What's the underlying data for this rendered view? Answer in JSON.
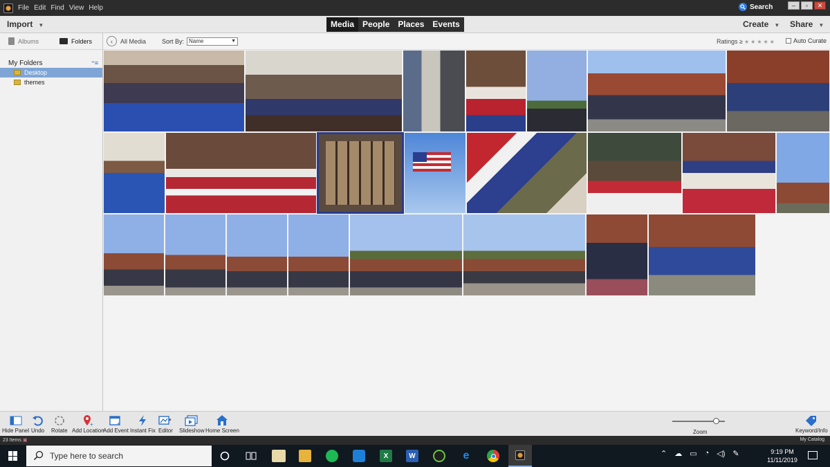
{
  "menu": [
    "File",
    "Edit",
    "Find",
    "View",
    "Help"
  ],
  "search_label": "Search",
  "window_controls": [
    "–",
    "▫",
    "✕"
  ],
  "topbar": {
    "import": "Import",
    "tabs": [
      "Media",
      "People",
      "Places",
      "Events"
    ],
    "active_tab": "Media",
    "create": "Create",
    "share": "Share"
  },
  "left_panel": {
    "albums": "Albums",
    "folders": "Folders",
    "my_folders": "My Folders",
    "tree": [
      {
        "label": "Desktop",
        "selected": true
      },
      {
        "label": "themes",
        "selected": false
      }
    ]
  },
  "content_toolbar": {
    "back": "All Media",
    "sort_by_label": "Sort By:",
    "sort_by_value": "Name",
    "ratings_label": "Ratings ≥",
    "auto_curate": "Auto Curate"
  },
  "bottom_tools": [
    {
      "label": "Hide Panel",
      "icon": "hide-panel-icon"
    },
    {
      "label": "Undo",
      "icon": "undo-icon"
    },
    {
      "label": "Rotate",
      "icon": "rotate-icon"
    },
    {
      "label": "Add Location",
      "icon": "location-pin-icon"
    },
    {
      "label": "Add Event",
      "icon": "add-event-icon"
    },
    {
      "label": "Instant Fix",
      "icon": "instant-fix-icon"
    },
    {
      "label": "Editor",
      "icon": "editor-icon"
    },
    {
      "label": "Slideshow",
      "icon": "slideshow-icon"
    },
    {
      "label": "Home Screen",
      "icon": "home-icon"
    }
  ],
  "zoom_label": "Zoom",
  "zoom_level": 0.88,
  "keyword_info": "Keyword/Info",
  "status": {
    "items": "23 Items",
    "catalog": "My Catalog"
  },
  "taskbar": {
    "search_placeholder": "Type here to search",
    "time": "9:19 PM",
    "date": "11/11/2019"
  }
}
